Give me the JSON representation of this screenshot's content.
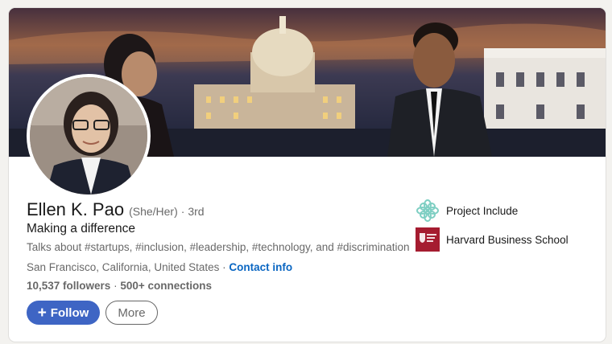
{
  "profile": {
    "name": "Ellen K. Pao",
    "pronouns": "(She/Her)",
    "degree": "· 3rd",
    "headline": "Making a difference",
    "talks_about": "Talks about #startups, #inclusion, #leadership, #technology, and #discrimination",
    "location": "San Francisco, California, United States",
    "location_separator": "·",
    "contact_info": "Contact info",
    "followers": "10,537 followers",
    "connections_separator": "·",
    "connections": "500+ connections"
  },
  "actions": {
    "follow_plus": "+",
    "follow_label": "Follow",
    "more_label": "More"
  },
  "organizations": [
    {
      "name": "Project Include",
      "icon": "project-include-logo",
      "color": "#7fcfc3"
    },
    {
      "name": "Harvard Business School",
      "icon": "harvard-shield-logo",
      "color": "#a51c30"
    }
  ],
  "colors": {
    "accent": "#0a66c2",
    "follow_button": "#3e65c4"
  }
}
